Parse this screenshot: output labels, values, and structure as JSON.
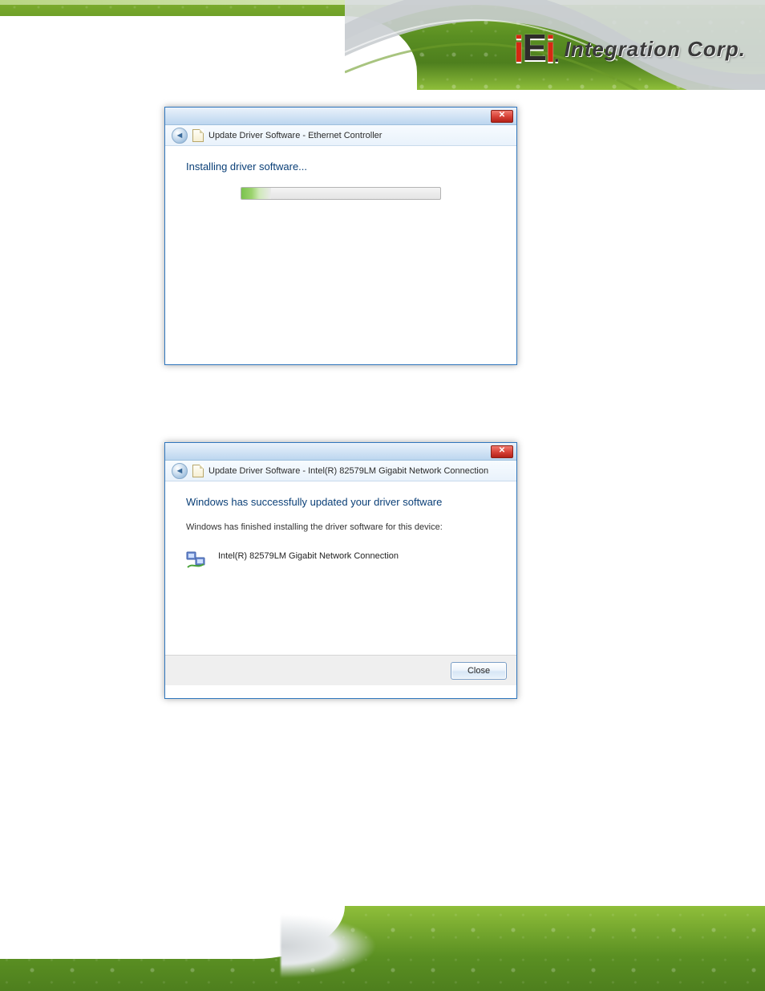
{
  "brand": {
    "logo_html": "iEi",
    "company_text": "Integration Corp."
  },
  "dialog1": {
    "crumb_label": "Update Driver Software - Ethernet Controller",
    "status": "Installing driver software...",
    "progress_percent": 15
  },
  "dialog2": {
    "crumb_label": "Update Driver Software - Intel(R) 82579LM Gigabit Network Connection",
    "status": "Windows has successfully updated your driver software",
    "subtext": "Windows has finished installing the driver software for this device:",
    "device_name": "Intel(R) 82579LM Gigabit Network Connection",
    "close_label": "Close"
  }
}
